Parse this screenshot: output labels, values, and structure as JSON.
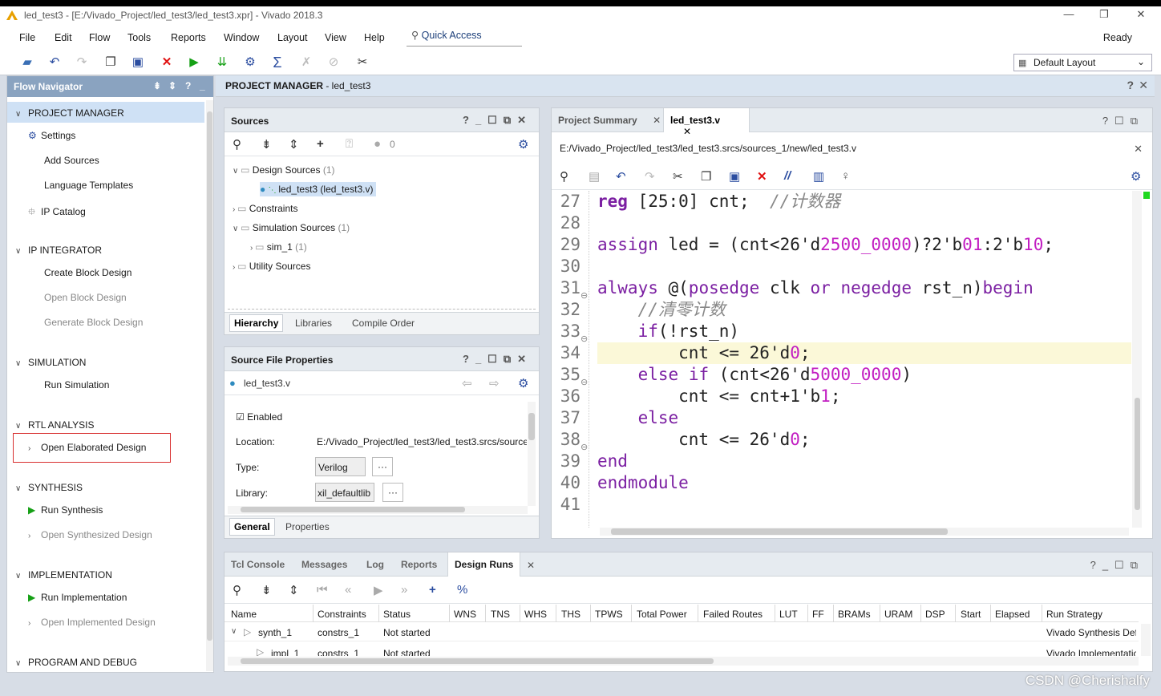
{
  "window": {
    "title": "led_test3 - [E:/Vivado_Project/led_test3/led_test3.xpr] - Vivado 2018.3"
  },
  "menu": [
    "File",
    "Edit",
    "Flow",
    "Tools",
    "Reports",
    "Window",
    "Layout",
    "View",
    "Help"
  ],
  "quick_access": "Quick Access",
  "status": "Ready",
  "layout_select": "Default Layout",
  "flow_nav": {
    "title": "Flow Navigator",
    "sections": {
      "pm": "PROJECT MANAGER",
      "ipi": "IP INTEGRATOR",
      "sim": "SIMULATION",
      "rtl": "RTL ANALYSIS",
      "syn": "SYNTHESIS",
      "impl": "IMPLEMENTATION",
      "prog": "PROGRAM AND DEBUG"
    },
    "items": {
      "settings": "Settings",
      "add_sources": "Add Sources",
      "lang_templates": "Language Templates",
      "ip_catalog": "IP Catalog",
      "create_bd": "Create Block Design",
      "open_bd": "Open Block Design",
      "gen_bd": "Generate Block Design",
      "run_sim": "Run Simulation",
      "open_elab": "Open Elaborated Design",
      "run_syn": "Run Synthesis",
      "open_syn": "Open Synthesized Design",
      "run_impl": "Run Implementation",
      "open_impl": "Open Implemented Design"
    }
  },
  "project_header": {
    "title": "PROJECT MANAGER",
    "project": " - led_test3"
  },
  "sources": {
    "title": "Sources",
    "count": "0",
    "tree": {
      "design": "Design Sources",
      "design_cnt": "(1)",
      "top": "led_test3 (led_test3.v)",
      "constraints": "Constraints",
      "sim": "Simulation Sources",
      "sim_cnt": "(1)",
      "sim1": "sim_1",
      "sim1_cnt": "(1)",
      "utility": "Utility Sources"
    },
    "tabs": [
      "Hierarchy",
      "Libraries",
      "Compile Order"
    ]
  },
  "sfp": {
    "title": "Source File Properties",
    "file": "led_test3.v",
    "enabled": "Enabled",
    "location_label": "Location:",
    "location_value": "E:/Vivado_Project/led_test3/led_test3.srcs/sources_1/new/led_test3.v",
    "type_label": "Type:",
    "type_value": "Verilog",
    "library_label": "Library:",
    "library_value": "xil_defaultlib",
    "dots": "···",
    "tabs": [
      "General",
      "Properties"
    ]
  },
  "editor": {
    "tabs": [
      "Project Summary",
      "led_test3.v"
    ],
    "path": "E:/Vivado_Project/led_test3/led_test3.srcs/sources_1/new/led_test3.v",
    "line_numbers": [
      "27",
      "28",
      "29",
      "30",
      "31",
      "32",
      "33",
      "34",
      "35",
      "36",
      "37",
      "38",
      "39",
      "40",
      "41"
    ]
  },
  "bottom": {
    "tabs": [
      "Tcl Console",
      "Messages",
      "Log",
      "Reports",
      "Design Runs"
    ],
    "columns": [
      "Name",
      "Constraints",
      "Status",
      "WNS",
      "TNS",
      "WHS",
      "THS",
      "TPWS",
      "Total Power",
      "Failed Routes",
      "LUT",
      "FF",
      "BRAMs",
      "URAM",
      "DSP",
      "Start",
      "Elapsed",
      "Run Strategy"
    ],
    "rows": [
      {
        "name": "synth_1",
        "constraints": "constrs_1",
        "status": "Not started",
        "strategy": "Vivado Synthesis Def"
      },
      {
        "name": "impl_1",
        "constraints": "constrs_1",
        "status": "Not started",
        "strategy": "Vivado Implementatic"
      }
    ]
  },
  "watermark": "CSDN @Cherishalfy"
}
